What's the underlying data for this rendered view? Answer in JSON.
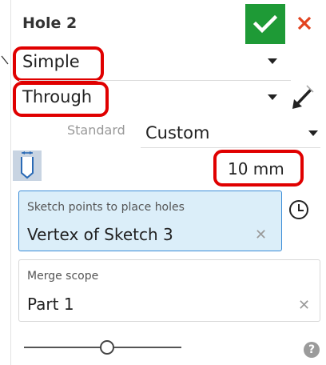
{
  "header": {
    "title": "Hole 2"
  },
  "hole_style": {
    "value": "Simple"
  },
  "termination": {
    "value": "Through"
  },
  "standard": {
    "label": "Standard",
    "value": "Custom"
  },
  "diameter": {
    "value": "10 mm"
  },
  "sketch_points": {
    "label": "Sketch points to place holes",
    "value": "Vertex of Sketch 3"
  },
  "merge_scope": {
    "label": "Merge scope",
    "value": "Part 1"
  },
  "slider": {
    "level": 0.53
  },
  "help": {
    "symbol": "?"
  },
  "colors": {
    "accent_green": "#1e9a36",
    "highlight_red": "#e00000",
    "selection_blue": "#dbeef9",
    "selection_border": "#3c8dd8"
  }
}
